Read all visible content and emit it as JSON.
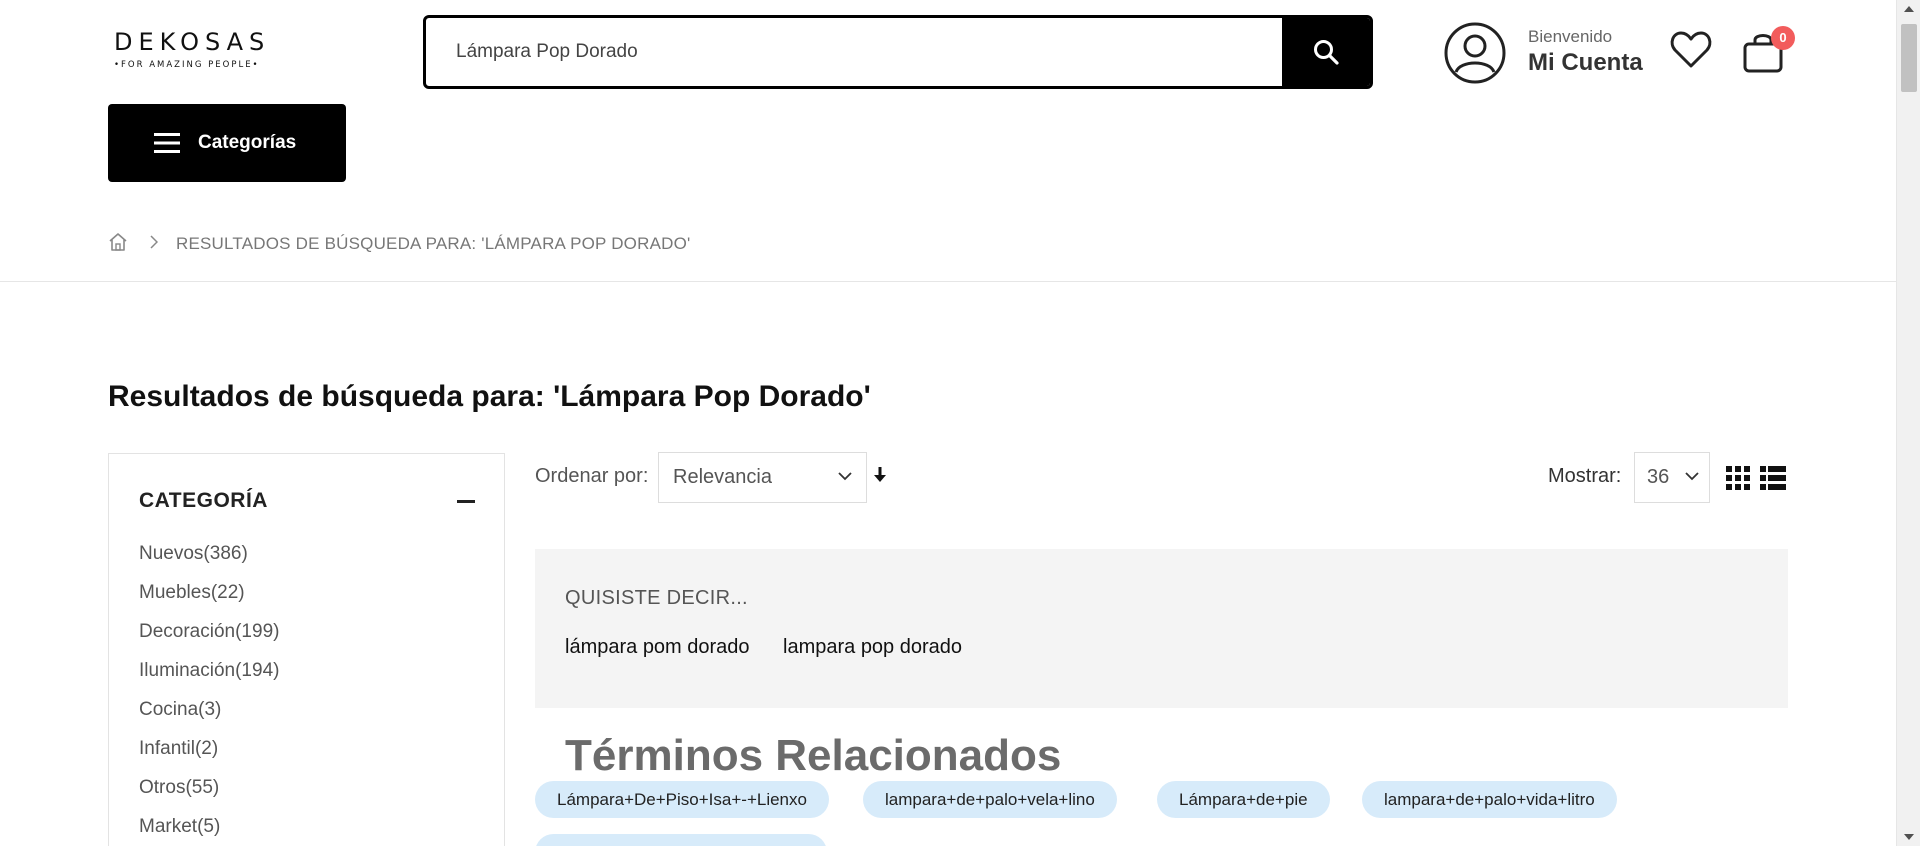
{
  "header": {
    "logo": {
      "brand": "DEKOSAS",
      "tagline": "•FOR AMAZING PEOPLE•"
    },
    "search": {
      "value": "Lámpara Pop Dorado",
      "icon": "search-icon"
    },
    "account": {
      "welcome": "Bienvenido",
      "name": "Mi Cuenta",
      "icon": "user-circle-icon"
    },
    "wishlist": {
      "icon": "heart-icon"
    },
    "cart": {
      "icon": "shopping-bag-icon",
      "count": "0"
    },
    "categories_button": {
      "label": "Categorías",
      "icon": "hamburger-icon"
    }
  },
  "breadcrumb": {
    "home_icon": "home-icon",
    "current": "RESULTADOS DE BÚSQUEDA PARA: 'LÁMPARA POP DORADO'"
  },
  "page_title": "Resultados de búsqueda para: 'Lámpara Pop Dorado'",
  "sidebar": {
    "heading": "CATEGORÍA",
    "items": [
      {
        "label": "Nuevos(386)"
      },
      {
        "label": "Muebles(22)"
      },
      {
        "label": "Decoración(199)"
      },
      {
        "label": "Iluminación(194)"
      },
      {
        "label": "Cocina(3)"
      },
      {
        "label": "Infantil(2)"
      },
      {
        "label": "Otros(55)"
      },
      {
        "label": "Market(5)"
      }
    ]
  },
  "toolbar": {
    "sort_label": "Ordenar por:",
    "sort_value": "Relevancia",
    "show_label": "Mostrar:",
    "show_value": "36"
  },
  "suggestions": {
    "heading": "QUISISTE DECIR...",
    "items": [
      "lámpara pom dorado",
      "lampara pop dorado"
    ]
  },
  "related": {
    "title": "Términos Relacionados",
    "terms": [
      "Lámpara+De+Piso+Isa+-+Lienxo",
      "lampara+de+palo+vela+lino",
      "Lámpara+de+pie",
      "lampara+de+palo+vida+litro"
    ]
  },
  "colors": {
    "accent": "#000000",
    "badge": "#f25c5c",
    "chip": "#d7ebfa",
    "suggest_bg": "#f4f4f4"
  }
}
